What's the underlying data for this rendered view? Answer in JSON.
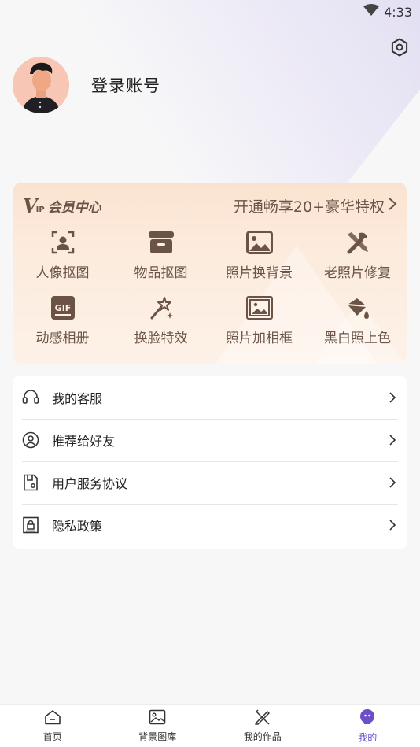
{
  "status_bar": {
    "time": "4:33",
    "icons": [
      "wifi-icon"
    ]
  },
  "profile": {
    "login_label": "登录账号",
    "avatar_icon": "user-avatar"
  },
  "settings": {
    "icon": "gear-icon"
  },
  "vip": {
    "logo_v": "V",
    "logo_ip": "IP",
    "title": "会员中心",
    "promo": "开通畅享20+豪华特权",
    "features": [
      {
        "label": "人像抠图",
        "icon": "portrait-cutout-icon"
      },
      {
        "label": "物品抠图",
        "icon": "box-cutout-icon"
      },
      {
        "label": "照片换背景",
        "icon": "image-background-icon"
      },
      {
        "label": "老照片修复",
        "icon": "tools-repair-icon"
      },
      {
        "label": "动感相册",
        "icon": "gif-album-icon"
      },
      {
        "label": "换脸特效",
        "icon": "magic-wand-icon"
      },
      {
        "label": "照片加相框",
        "icon": "photo-frame-icon"
      },
      {
        "label": "黑白照上色",
        "icon": "paint-bucket-icon"
      }
    ],
    "colors": {
      "text": "#6b5346",
      "bg_top": "#fbe2cf",
      "bg_bottom": "#fdf1e7"
    }
  },
  "menu": {
    "items": [
      {
        "label": "我的客服",
        "icon": "headset-icon"
      },
      {
        "label": "推荐给好友",
        "icon": "user-circle-icon"
      },
      {
        "label": "用户服务协议",
        "icon": "document-icon"
      },
      {
        "label": "隐私政策",
        "icon": "lock-document-icon"
      }
    ]
  },
  "bottom_nav": {
    "items": [
      {
        "label": "首页",
        "icon": "home-icon"
      },
      {
        "label": "背景图库",
        "icon": "gallery-icon"
      },
      {
        "label": "我的作品",
        "icon": "edit-tools-icon"
      },
      {
        "label": "我的",
        "icon": "profile-face-icon",
        "active": true
      }
    ],
    "active_color": "#6a4fc7"
  }
}
